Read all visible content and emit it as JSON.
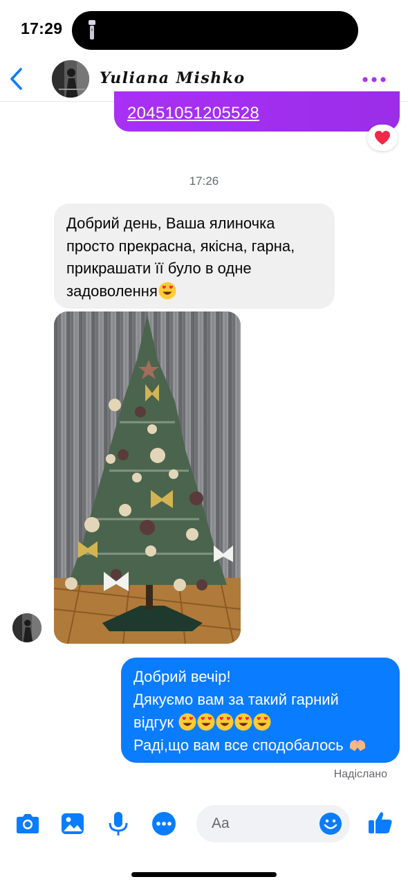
{
  "status_bar": {
    "time": "17:29"
  },
  "header": {
    "contact_name": "Yuliana Mishko",
    "back_icon": "chevron-left-icon",
    "more_icon": "more-dots-icon",
    "accent_color": "#a931f6"
  },
  "messages": {
    "previous_link": {
      "text": "20451051205528",
      "color": "#a931f6",
      "reaction": "♥"
    },
    "timestamp": "17:26",
    "incoming": {
      "lines": [
        "Добрий день, Ваша ялиночка",
        "просто прекрасна, якісна, гарна,",
        "прикрашати її було в одне",
        "задоволення"
      ],
      "emoji": "heart-eyes"
    },
    "photo": {
      "subject": "decorated christmas tree"
    },
    "outgoing": {
      "lines": [
        "Добрий вечір!",
        "Дякуємо вам за такий гарний",
        "відгук",
        "Раді,що вам все сподобалось"
      ],
      "color": "#0a7cff"
    },
    "sent_status": "Надіслано"
  },
  "composer": {
    "placeholder": "Aa",
    "icons": [
      "camera-icon",
      "gallery-icon",
      "microphone-icon",
      "more-icon",
      "emoji-icon",
      "like-icon"
    ],
    "icon_color": "#0a7cff"
  }
}
